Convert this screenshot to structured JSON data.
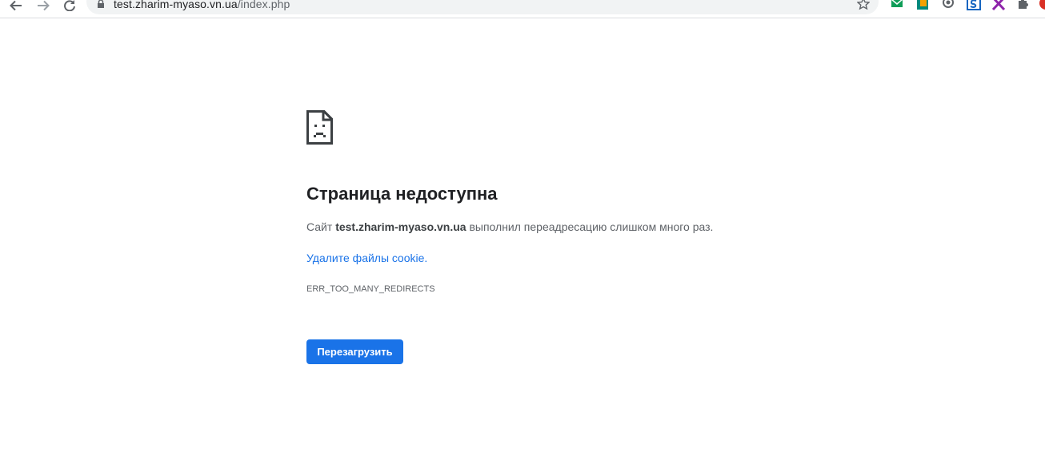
{
  "browser": {
    "url_host": "test.zharim-myaso.vn.ua",
    "url_path": "/index.php",
    "icons": {
      "back": "back-arrow-icon",
      "forward": "forward-arrow-icon",
      "reload": "reload-icon",
      "lock": "lock-icon",
      "bookmark": "star-icon",
      "extensions": "puzzle-icon"
    },
    "extension_colors": [
      "#0f9d58",
      "#f4a100",
      "#5f6368",
      "#1565c0",
      "#8e24aa",
      "#d93025"
    ]
  },
  "error": {
    "icon": "sad-page-icon",
    "title": "Страница недоступна",
    "summary_prefix": "Сайт ",
    "summary_host": "test.zharim-myaso.vn.ua",
    "summary_suffix": " выполнил переадресацию слишком много раз.",
    "cookie_link": "Удалите файлы cookie.",
    "code": "ERR_TOO_MANY_REDIRECTS",
    "reload_label": "Перезагрузить"
  },
  "colors": {
    "accent": "#1a73e8",
    "text": "#202124",
    "secondary_text": "#5f6368"
  }
}
